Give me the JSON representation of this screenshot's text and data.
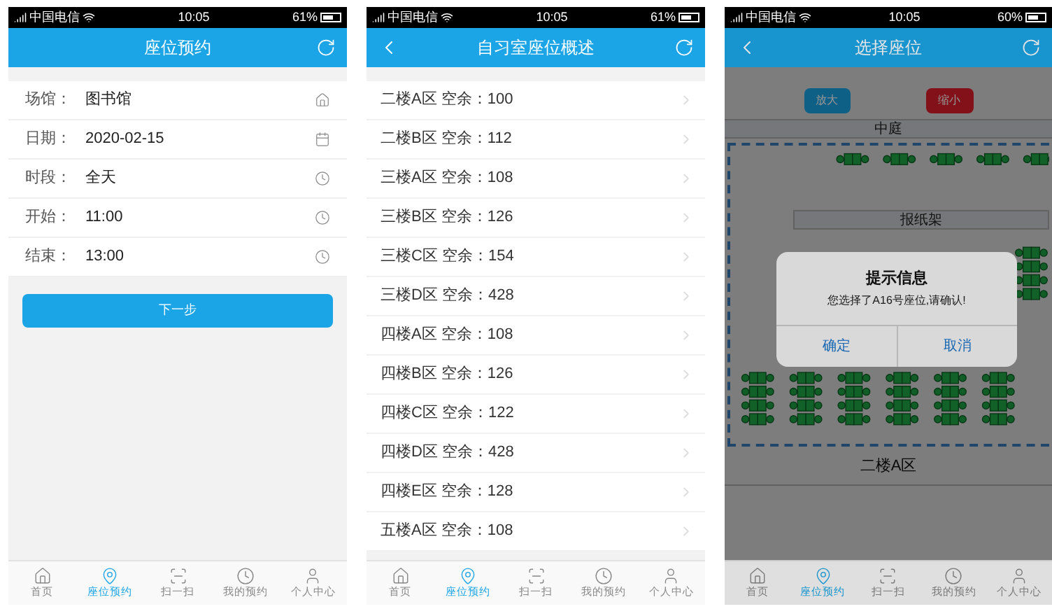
{
  "screens": [
    {
      "kind": "form",
      "status_bar": {
        "carrier": "中国电信",
        "time": "10:05",
        "battery": "61%"
      },
      "nav": {
        "title": "座位预约",
        "back": false
      },
      "fields": [
        {
          "kind": "place",
          "label": "场馆：",
          "value": "图书馆"
        },
        {
          "kind": "date",
          "label": "日期：",
          "value": "2020-02-15"
        },
        {
          "kind": "time",
          "label": "时段：",
          "value": "全天"
        },
        {
          "kind": "time",
          "label": "开始：",
          "value": "11:00"
        },
        {
          "kind": "time",
          "label": "结束：",
          "value": "13:00"
        }
      ],
      "button": "下一步",
      "tab_bar": [
        {
          "kind": "home",
          "label": "首页",
          "selected": false
        },
        {
          "kind": "pin",
          "label": "座位预约",
          "selected": true
        },
        {
          "kind": "scan",
          "label": "扫一扫",
          "selected": false
        },
        {
          "kind": "clock",
          "label": "我的预约",
          "selected": false
        },
        {
          "kind": "user",
          "label": "个人中心",
          "selected": false
        }
      ]
    },
    {
      "kind": "list",
      "status_bar": {
        "carrier": "中国电信",
        "time": "10:05",
        "battery": "61%"
      },
      "nav": {
        "title": "自习室座位概述",
        "back": true
      },
      "rows": [
        "二楼A区 空余：100",
        "二楼B区 空余：112",
        "三楼A区 空余：108",
        "三楼B区 空余：126",
        "三楼C区 空余：154",
        "三楼D区 空余：428",
        "四楼A区 空余：108",
        "四楼B区 空余：126",
        "四楼C区 空余：122",
        "四楼D区 空余：428",
        "四楼E区 空余：128",
        "五楼A区 空余：108"
      ],
      "tab_bar": [
        {
          "kind": "home",
          "label": "首页",
          "selected": false
        },
        {
          "kind": "pin",
          "label": "座位预约",
          "selected": true
        },
        {
          "kind": "scan",
          "label": "扫一扫",
          "selected": false
        },
        {
          "kind": "clock",
          "label": "我的预约",
          "selected": false
        },
        {
          "kind": "user",
          "label": "个人中心",
          "selected": false
        }
      ]
    },
    {
      "kind": "map",
      "status_bar": {
        "carrier": "中国电信",
        "time": "10:05",
        "battery": "60%"
      },
      "nav": {
        "title": "选择座位",
        "back": true
      },
      "zoom_in": "放大",
      "zoom_out": "缩小",
      "landmark": "中庭",
      "shelf": "报纸架",
      "area": "二楼A区",
      "dialog": {
        "title": "提示信息",
        "message": "您选择了A16号座位,请确认!",
        "buttons": [
          "确定",
          "取消"
        ]
      },
      "tab_bar": [
        {
          "kind": "home",
          "label": "首页",
          "selected": false
        },
        {
          "kind": "pin",
          "label": "座位预约",
          "selected": true
        },
        {
          "kind": "scan",
          "label": "扫一扫",
          "selected": false
        },
        {
          "kind": "clock",
          "label": "我的预约",
          "selected": false
        },
        {
          "kind": "user",
          "label": "个人中心",
          "selected": false
        }
      ]
    }
  ]
}
